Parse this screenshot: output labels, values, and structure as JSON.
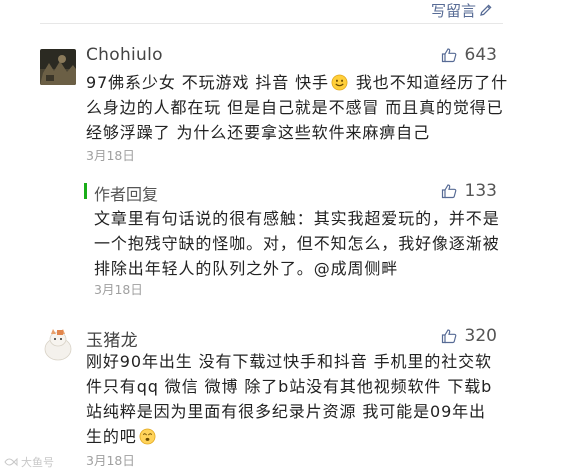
{
  "header": {
    "write_comment_label": "写留言"
  },
  "comments": [
    {
      "author": "Chohiulo",
      "likes": "643",
      "text_before_emoji": "97佛系少女 不玩游戏 抖音 快手",
      "text_after_emoji": " 我也不知道经历了什么身边的人都在玩 但是自己就是不感冒 而且真的觉得已经够浮躁了 为什么还要拿这些软件来麻痹自己",
      "date": "3月18日",
      "reply": {
        "label": "作者回复",
        "likes": "133",
        "text": "文章里有句话说的很有感触：其实我超爱玩的，并不是一个抱残守缺的怪咖。对，但不知怎么，我好像逐渐被排除出年轻人的队列之外了。@成周侧畔",
        "date": "3月18日"
      }
    },
    {
      "author": "玉猪龙",
      "likes": "320",
      "text_before_emoji": "刚好90年出生  没有下载过快手和抖音  手机里的社交软件只有qq  微信  微博    除了b站没有其他视频软件    下载b站纯粹是因为里面有很多纪录片资源     我可能是09年出生的吧",
      "date": "3月18日"
    }
  ],
  "watermark": "大鱼号"
}
